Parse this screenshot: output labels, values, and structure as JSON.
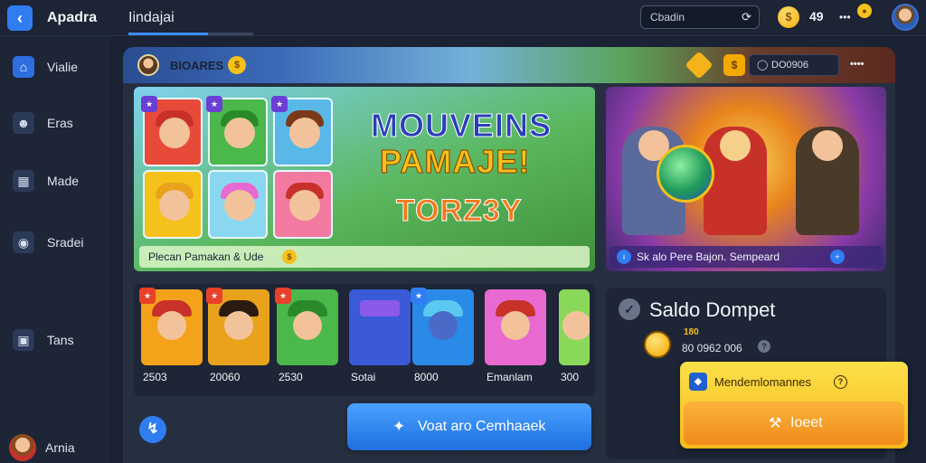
{
  "topbar": {
    "back_icon": "back-arrow-icon",
    "app_title": "Apadra",
    "tab_label": "Iindajai",
    "search_placeholder": "Cbadin",
    "coin_count": "49",
    "extra": "•••",
    "avatar": "user-avatar"
  },
  "sidebar": {
    "items": [
      {
        "label": "Vialie",
        "icon": "home-icon"
      },
      {
        "label": "Eras",
        "icon": "user-icon"
      },
      {
        "label": "Made",
        "icon": "calendar-icon"
      },
      {
        "label": "Sradei",
        "icon": "location-icon"
      },
      {
        "label": "Tans",
        "icon": "tv-icon"
      }
    ],
    "profile_label": "Arnia"
  },
  "panel_header": {
    "title": "BIOARES",
    "search_text": "DO0906",
    "dots": "••••"
  },
  "banner_left": {
    "headline_1": "MOUVEINS",
    "headline_2": "PAMAJE!",
    "headline_3": "TORZ3Y",
    "caption": "Plecan Pamakan & Ude"
  },
  "banner_right": {
    "caption": "Sk alo Pere Bajon. Sempeard"
  },
  "games": [
    {
      "label": "2503"
    },
    {
      "label": "20060"
    },
    {
      "label": "2530"
    },
    {
      "label": "Sotai"
    },
    {
      "label": "8000"
    },
    {
      "label": "Emanlam"
    },
    {
      "label": "300"
    }
  ],
  "saldo": {
    "title": "Saldo Dompet",
    "tag": "180",
    "value": "80 0962 006"
  },
  "promo": {
    "text": "Mendemlomannes",
    "button_label": "Ioeet"
  },
  "cta": {
    "label": "Voat aro Cemhaaek"
  },
  "colors": {
    "accent": "#2f7df0",
    "promo": "#f5b81b",
    "panel": "#262f40"
  }
}
